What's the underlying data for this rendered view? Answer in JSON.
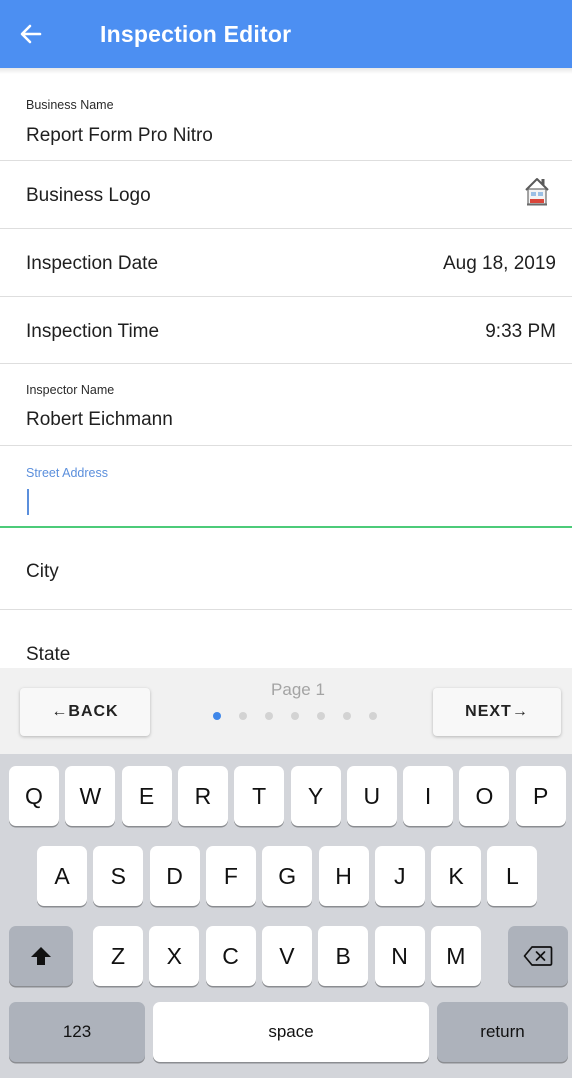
{
  "header": {
    "title": "Inspection Editor",
    "back_icon": "arrow-left-icon",
    "color": "#4c8ff2"
  },
  "form": {
    "business_name": {
      "label": "Business Name",
      "value": "Report Form Pro Nitro"
    },
    "business_logo": {
      "label": "Business Logo",
      "icon": "house-logo-icon"
    },
    "inspection_date": {
      "label": "Inspection Date",
      "value": "Aug 18, 2019"
    },
    "inspection_time": {
      "label": "Inspection Time",
      "value": "9:33 PM"
    },
    "inspector_name": {
      "label": "Inspector Name",
      "value": "Robert Eichmann"
    },
    "street_address": {
      "label": "Street Address",
      "value": ""
    },
    "city": {
      "label": "City"
    },
    "state": {
      "label": "State"
    }
  },
  "pager": {
    "back_label": "←BACK",
    "next_label": "NEXT→",
    "page_label": "Page 1",
    "total_pages": 7,
    "current_page": 1,
    "active_dot_color": "#3f87e9"
  },
  "keyboard": {
    "row1": [
      "Q",
      "W",
      "E",
      "R",
      "T",
      "Y",
      "U",
      "I",
      "O",
      "P"
    ],
    "row2": [
      "A",
      "S",
      "D",
      "F",
      "G",
      "H",
      "J",
      "K",
      "L"
    ],
    "row3": [
      "Z",
      "X",
      "C",
      "V",
      "B",
      "N",
      "M"
    ],
    "shift_icon": "shift-arrow-icon",
    "delete_icon": "backspace-icon",
    "numbers_label": "123",
    "space_label": "space",
    "return_label": "return"
  },
  "colors": {
    "focus_underline": "#4ccb79",
    "focus_label": "#5b8fdc"
  }
}
